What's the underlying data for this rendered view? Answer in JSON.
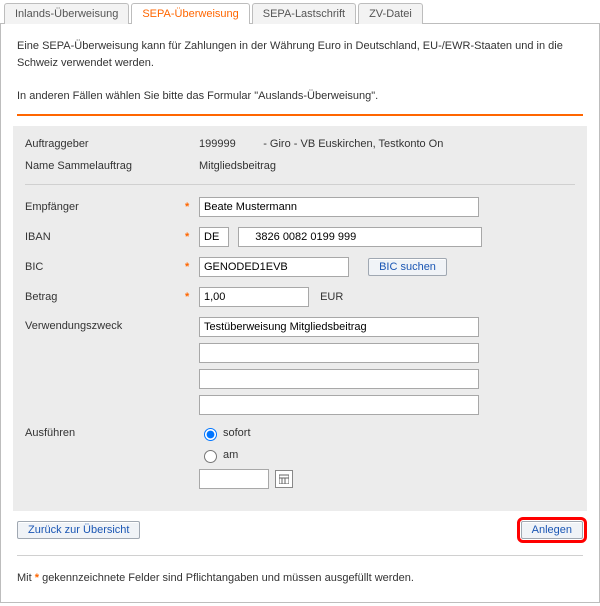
{
  "tabs": {
    "inland": "Inlands-Überweisung",
    "sepa": "SEPA-Überweisung",
    "last": "SEPA-Lastschrift",
    "zv": "ZV-Datei"
  },
  "intro": {
    "p1": "Eine SEPA-Überweisung kann für Zahlungen in der Währung Euro in Deutschland, EU-/EWR-Staaten und in die Schweiz verwendet werden.",
    "p2": "In anderen Fällen wählen Sie bitte das Formular \"Auslands-Überweisung\"."
  },
  "labels": {
    "auftraggeber": "Auftraggeber",
    "sammel": "Name Sammelauftrag",
    "empfaenger": "Empfänger",
    "iban": "IBAN",
    "bic": "BIC",
    "betrag": "Betrag",
    "vwz": "Verwendungszweck",
    "ausfuehren": "Ausführen"
  },
  "values": {
    "auftraggeber": "199999         - Giro - VB Euskirchen, Testkonto On",
    "sammel": "Mitgliedsbeitrag",
    "empfaenger": "Beate Mustermann",
    "iban_country": "DE",
    "iban_rest": "    3826 0082 0199 999",
    "bic": "GENODED1EVB",
    "betrag": "1,00",
    "waehrung": "EUR",
    "vwz1": "Testüberweisung Mitgliedsbeitrag",
    "vwz2": "",
    "vwz3": "",
    "vwz4": ""
  },
  "radio": {
    "sofort": "sofort",
    "am": "am"
  },
  "buttons": {
    "bic_suchen": "BIC suchen",
    "zurueck": "Zurück zur Übersicht",
    "anlegen": "Anlegen"
  },
  "note": {
    "prefix": "Mit ",
    "suffix": " gekennzeichnete Felder sind Pflichtangaben und müssen ausgefüllt werden."
  },
  "asterisk": "*"
}
